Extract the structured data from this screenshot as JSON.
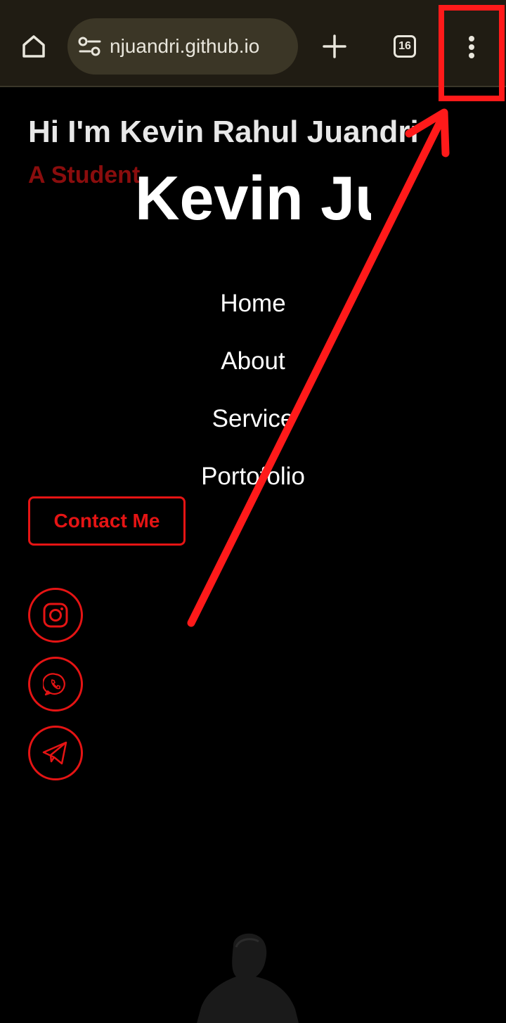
{
  "browser": {
    "url": "njuandri.github.io",
    "tab_count": "16",
    "icons": {
      "home": "home-icon",
      "site_settings": "tune-icon",
      "new_tab": "plus-icon",
      "tabs": "tab-switcher-icon",
      "menu": "more-vert-icon"
    }
  },
  "hero": {
    "title": "Hi I'm Kevin Rahul Juandri",
    "subtitle": "A Student",
    "big_name": "Kevin Juandri"
  },
  "nav": {
    "items": [
      {
        "label": "Home"
      },
      {
        "label": "About"
      },
      {
        "label": "Service"
      },
      {
        "label": "Portofolio"
      }
    ]
  },
  "contact": {
    "label": "Contact Me"
  },
  "social": {
    "icons": [
      "instagram-icon",
      "whatsapp-icon",
      "telegram-icon"
    ]
  },
  "colors": {
    "accent": "#e51414",
    "toolbar_bg": "#201c13",
    "annotation": "#ff1a1a"
  }
}
